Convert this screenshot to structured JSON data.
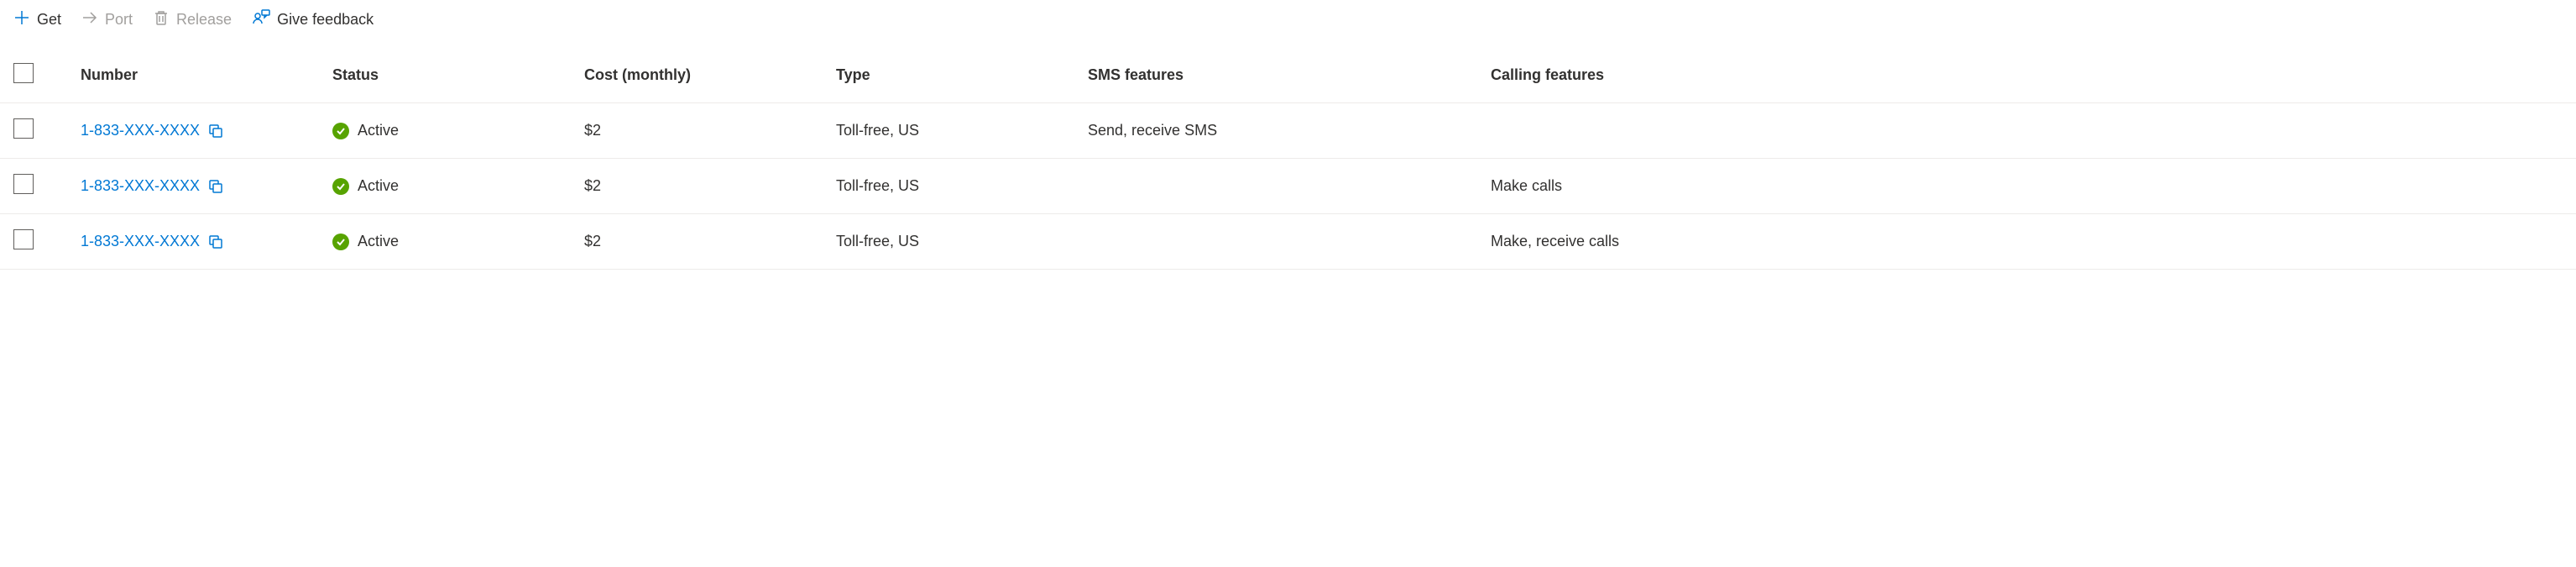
{
  "toolbar": {
    "get_label": "Get",
    "port_label": "Port",
    "release_label": "Release",
    "feedback_label": "Give feedback"
  },
  "columns": {
    "number": "Number",
    "status": "Status",
    "cost": "Cost (monthly)",
    "type": "Type",
    "sms": "SMS features",
    "calling": "Calling features"
  },
  "rows": [
    {
      "number": "1-833-XXX-XXXX",
      "status": "Active",
      "cost": "$2",
      "type": "Toll-free, US",
      "sms": "Send, receive SMS",
      "calling": ""
    },
    {
      "number": "1-833-XXX-XXXX",
      "status": "Active",
      "cost": "$2",
      "type": "Toll-free, US",
      "sms": "",
      "calling": "Make calls"
    },
    {
      "number": "1-833-XXX-XXXX",
      "status": "Active",
      "cost": "$2",
      "type": "Toll-free, US",
      "sms": "",
      "calling": "Make, receive calls"
    }
  ]
}
